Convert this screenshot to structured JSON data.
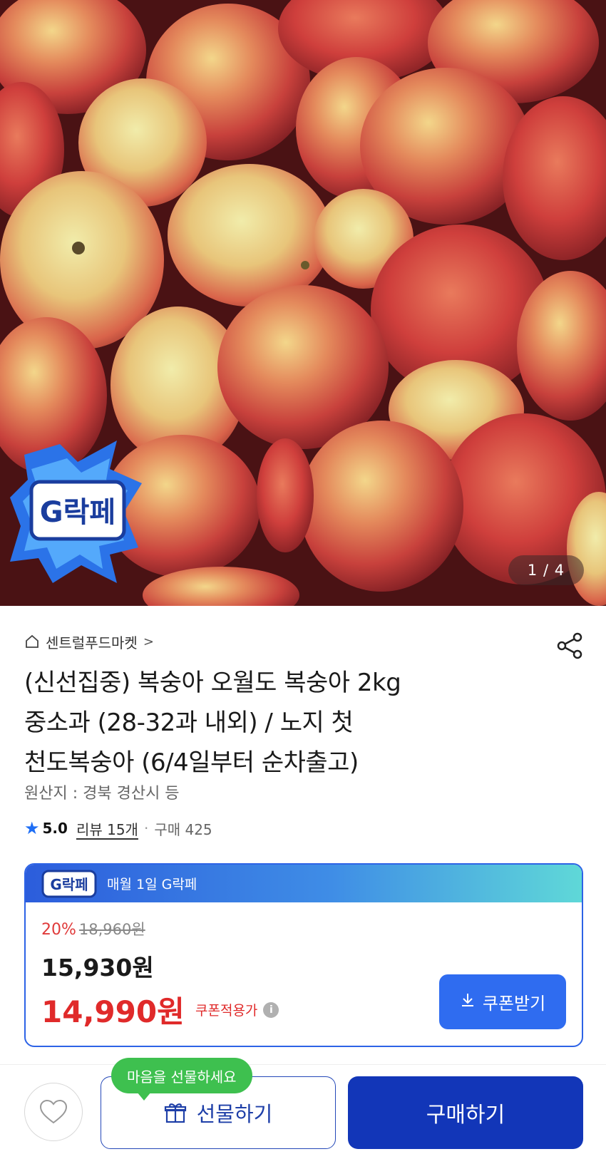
{
  "gallery": {
    "page_indicator": "1 / 4",
    "badge_text": "G락페"
  },
  "product": {
    "seller_name": "센트럴푸드마켓",
    "seller_chevron": ">",
    "title_lines": [
      "(신선집중) 복숭아 오월도 복숭아 2kg",
      "중소과 (28-32과 내외) / 노지 첫",
      "천도복숭아 (6/4일부터 순차출고)"
    ],
    "origin": "원산지 : 경북 경산시 등",
    "rating": "5.0",
    "reviews": "리뷰 15개",
    "separator": "·",
    "purchases": "구매 425"
  },
  "price": {
    "banner_badge": "G락페",
    "banner_text": "매월 1일 G락페",
    "discount_rate": "20%",
    "original_price": "18,960원",
    "sale_price": "15,930원",
    "coupon_price": "14,990원",
    "coupon_label": "쿠폰적용가",
    "coupon_button": "쿠폰받기"
  },
  "bottom_bar": {
    "gift_tooltip": "마음을 선물하세요",
    "gift_button": "선물하기",
    "buy_button": "구매하기"
  },
  "colors": {
    "accent_blue": "#2f6cf0",
    "buy_blue": "#1236b8",
    "price_red": "#e02a2a",
    "tooltip_green": "#3ec04f"
  }
}
